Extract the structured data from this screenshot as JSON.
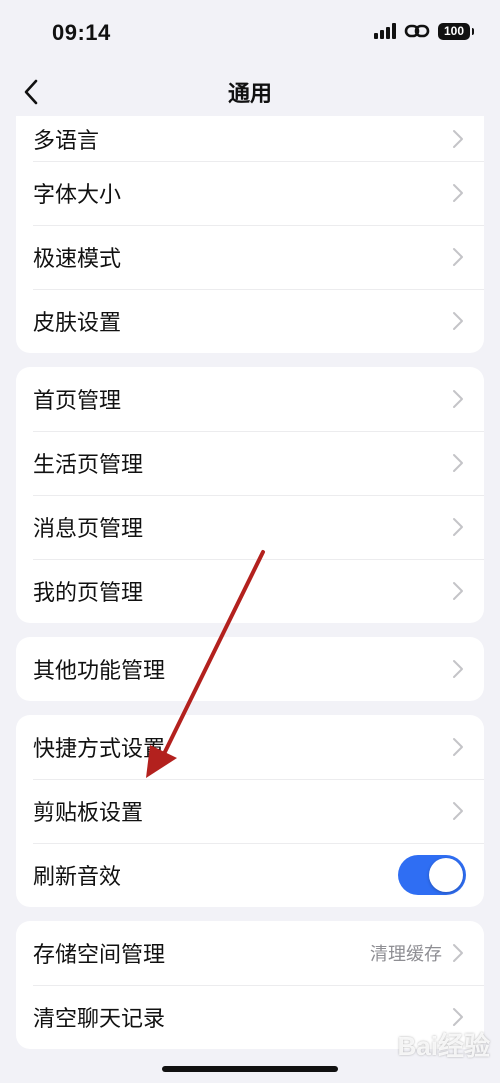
{
  "status": {
    "time": "09:14",
    "battery": "100"
  },
  "header": {
    "title": "通用"
  },
  "groups": [
    {
      "items": [
        {
          "label": "多语言"
        },
        {
          "label": "字体大小"
        },
        {
          "label": "极速模式"
        },
        {
          "label": "皮肤设置"
        }
      ]
    },
    {
      "items": [
        {
          "label": "首页管理"
        },
        {
          "label": "生活页管理"
        },
        {
          "label": "消息页管理"
        },
        {
          "label": "我的页管理"
        }
      ]
    },
    {
      "items": [
        {
          "label": "其他功能管理"
        }
      ]
    },
    {
      "items": [
        {
          "label": "快捷方式设置"
        },
        {
          "label": "剪贴板设置"
        },
        {
          "label": "刷新音效",
          "toggle": true
        }
      ]
    },
    {
      "items": [
        {
          "label": "存储空间管理",
          "value": "清理缓存"
        },
        {
          "label": "清空聊天记录"
        }
      ]
    }
  ],
  "watermark": "Bai经验",
  "colors": {
    "accent": "#2f6ef3",
    "background": "#f2f2f7",
    "arrow": "#b3211e"
  }
}
